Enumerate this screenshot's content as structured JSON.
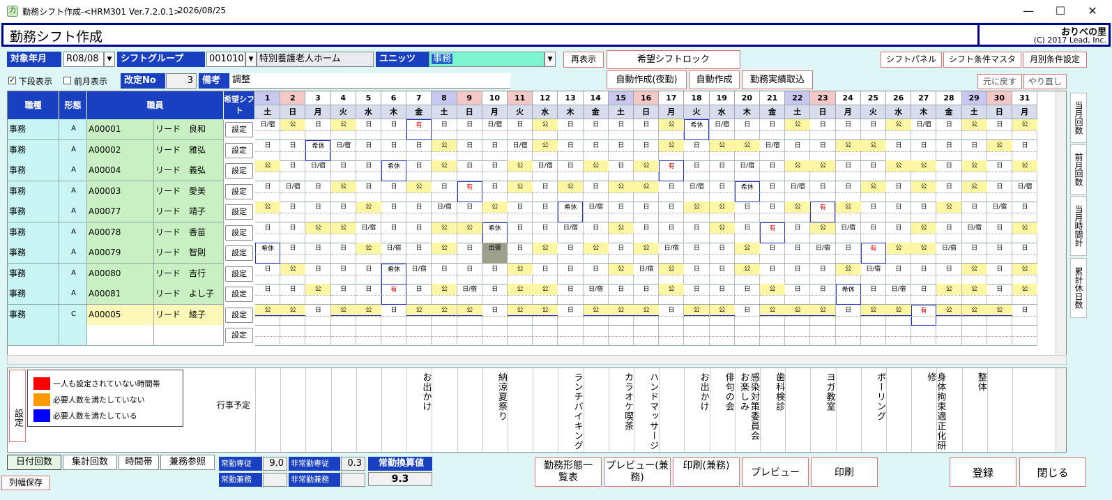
{
  "window": {
    "title": "勤務シフト作成-<HRM301 Ver.7.2.0.1>",
    "date": "2026/08/25",
    "icon_text": "力"
  },
  "header": {
    "title": "勤務シフト作成",
    "brand": "おりべの里",
    "copyright": "(C) 2017 Lead, Inc."
  },
  "filters": {
    "month_label": "対象年月",
    "month_value": "R08/08",
    "group_label": "シフトグループ",
    "group_code": "001010",
    "group_name": "特別養護老人ホーム",
    "unit_label": "ユニッツ",
    "unit_value": "事務",
    "show_lower": "下段表示",
    "show_prev": "前月表示",
    "revision_label": "改定No",
    "revision_value": "3",
    "note_label": "備考",
    "note_value": "調整"
  },
  "buttons": {
    "refresh": "再表示",
    "lock": "希望シフトロック",
    "auto_night": "自動作成(夜勤)",
    "auto": "自動作成",
    "import": "勤務実績取込",
    "panel": "シフトパネル",
    "master": "シフト条件マスタ",
    "monthly": "月別条件設定",
    "undo": "元に戻す",
    "redo": "やり直し",
    "set": "設定"
  },
  "grid": {
    "headers": {
      "job": "職種",
      "form": "形態",
      "staff": "職員",
      "hope": "希望シフト"
    },
    "days": [
      {
        "d": "1",
        "w": "土",
        "t": "sat"
      },
      {
        "d": "2",
        "w": "日",
        "t": "sun"
      },
      {
        "d": "3",
        "w": "月",
        "t": ""
      },
      {
        "d": "4",
        "w": "火",
        "t": ""
      },
      {
        "d": "5",
        "w": "水",
        "t": ""
      },
      {
        "d": "6",
        "w": "木",
        "t": ""
      },
      {
        "d": "7",
        "w": "金",
        "t": ""
      },
      {
        "d": "8",
        "w": "土",
        "t": "sat"
      },
      {
        "d": "9",
        "w": "日",
        "t": "sun"
      },
      {
        "d": "10",
        "w": "月",
        "t": ""
      },
      {
        "d": "11",
        "w": "火",
        "t": "sun"
      },
      {
        "d": "12",
        "w": "水",
        "t": ""
      },
      {
        "d": "13",
        "w": "木",
        "t": ""
      },
      {
        "d": "14",
        "w": "金",
        "t": ""
      },
      {
        "d": "15",
        "w": "土",
        "t": "sat"
      },
      {
        "d": "16",
        "w": "日",
        "t": "sun"
      },
      {
        "d": "17",
        "w": "月",
        "t": ""
      },
      {
        "d": "18",
        "w": "火",
        "t": ""
      },
      {
        "d": "19",
        "w": "水",
        "t": ""
      },
      {
        "d": "20",
        "w": "木",
        "t": ""
      },
      {
        "d": "21",
        "w": "金",
        "t": ""
      },
      {
        "d": "22",
        "w": "土",
        "t": "sat"
      },
      {
        "d": "23",
        "w": "日",
        "t": "sun"
      },
      {
        "d": "24",
        "w": "月",
        "t": ""
      },
      {
        "d": "25",
        "w": "火",
        "t": ""
      },
      {
        "d": "26",
        "w": "水",
        "t": ""
      },
      {
        "d": "27",
        "w": "木",
        "t": ""
      },
      {
        "d": "28",
        "w": "金",
        "t": ""
      },
      {
        "d": "29",
        "w": "土",
        "t": "sat"
      },
      {
        "d": "30",
        "w": "日",
        "t": "sun"
      },
      {
        "d": "31",
        "w": "月",
        "t": ""
      }
    ],
    "rows": [
      {
        "job": "事務",
        "form": "A",
        "code": "A00001",
        "name": "リード　良和",
        "shifts": [
          "日/宿",
          "公",
          "日",
          "公",
          "日",
          "日",
          "有",
          "日",
          "日",
          "日/宿",
          "日",
          "公",
          "日",
          "日",
          "日",
          "日",
          "公",
          "希休",
          "日/宿",
          "日",
          "日",
          "公",
          "日",
          "日",
          "日",
          "公",
          "日/宿",
          "日",
          "公",
          "日",
          "公"
        ]
      },
      {
        "job": "事務",
        "form": "A",
        "code": "A00002",
        "name": "リード　雅弘",
        "shifts": [
          "日",
          "日",
          "希休",
          "日/宿",
          "日",
          "日",
          "日",
          "公",
          "日",
          "日",
          "日/宿",
          "公",
          "日",
          "日",
          "日",
          "日",
          "公",
          "日",
          "公",
          "公",
          "日/宿",
          "日",
          "日",
          "公",
          "公",
          "日",
          "日",
          "日",
          "日",
          "公",
          "日"
        ]
      },
      {
        "job": "事務",
        "form": "A",
        "code": "A00004",
        "name": "リード　義弘",
        "shifts": [
          "公",
          "日",
          "日/宿",
          "日",
          "日",
          "希休",
          "日",
          "公",
          "日",
          "日",
          "公",
          "日/宿",
          "日",
          "公",
          "日",
          "公",
          "有",
          "日",
          "日",
          "日/宿",
          "日",
          "公",
          "公",
          "日",
          "日",
          "公",
          "公",
          "日",
          "公",
          "日",
          "公"
        ]
      },
      {
        "job": "事務",
        "form": "A",
        "code": "A00003",
        "name": "リード　愛美",
        "shifts": [
          "日",
          "日/宿",
          "日",
          "公",
          "日",
          "日",
          "公",
          "日",
          "有",
          "日",
          "公",
          "日",
          "公",
          "日",
          "公",
          "公",
          "日",
          "日/宿",
          "日",
          "希休",
          "日",
          "日/宿",
          "日",
          "日",
          "公",
          "日",
          "公",
          "日",
          "公",
          "日",
          "日/宿"
        ]
      },
      {
        "job": "事務",
        "form": "A",
        "code": "A00077",
        "name": "リード　靖子",
        "shifts": [
          "公",
          "日",
          "日",
          "日",
          "公",
          "日",
          "日",
          "日/宿",
          "日",
          "公",
          "日",
          "日",
          "希休",
          "日/宿",
          "日",
          "日",
          "日",
          "公",
          "公",
          "日",
          "日",
          "公",
          "有",
          "公",
          "日",
          "日",
          "日",
          "公",
          "日",
          "日/宿",
          "日"
        ]
      },
      {
        "job": "事務",
        "form": "A",
        "code": "A00078",
        "name": "リード　香苗",
        "shifts": [
          "日",
          "日",
          "公",
          "公",
          "日/宿",
          "日",
          "日",
          "公",
          "公",
          "希休",
          "日",
          "日",
          "日/宿",
          "日",
          "公",
          "日",
          "日",
          "日",
          "公",
          "日",
          "有",
          "日",
          "公",
          "日/宿",
          "日",
          "日",
          "公",
          "日",
          "日/宿",
          "日",
          "公"
        ]
      },
      {
        "job": "事務",
        "form": "A",
        "code": "A00079",
        "name": "リード　智則",
        "shifts": [
          "希休",
          "日",
          "日",
          "日",
          "公",
          "日/宿",
          "日",
          "公",
          "日",
          "出張",
          "日",
          "公",
          "日",
          "公",
          "日",
          "公",
          "日/宿",
          "日",
          "日",
          "公",
          "日",
          "日",
          "日/宿",
          "日",
          "有",
          "公",
          "公",
          "日/宿",
          "日",
          "日",
          "日"
        ]
      },
      {
        "job": "事務",
        "form": "A",
        "code": "A00080",
        "name": "リード　吉行",
        "shifts": [
          "日",
          "公",
          "日",
          "日",
          "日",
          "希休",
          "日/宿",
          "日",
          "日",
          "日",
          "公",
          "日",
          "日",
          "日",
          "公",
          "日/宿",
          "公",
          "日",
          "日",
          "公",
          "日",
          "日",
          "日",
          "公",
          "日/宿",
          "日",
          "日",
          "日",
          "公",
          "日",
          "公"
        ]
      },
      {
        "job": "事務",
        "form": "A",
        "code": "A00081",
        "name": "リード　よし子",
        "shifts": [
          "日",
          "日",
          "公",
          "日",
          "日",
          "有",
          "日",
          "公",
          "日/宿",
          "日",
          "公",
          "公",
          "日",
          "日/宿",
          "日",
          "日",
          "公",
          "日",
          "日",
          "日",
          "公",
          "日",
          "日",
          "希休",
          "日",
          "日/宿",
          "日",
          "公",
          "公",
          "日",
          "公"
        ]
      },
      {
        "job": "事務",
        "form": "C",
        "code": "A00005",
        "name": "リード　綾子",
        "shifts": [
          "公",
          "公",
          "日",
          "公",
          "公",
          "日",
          "公",
          "公",
          "公",
          "日",
          "公",
          "公",
          "日",
          "公",
          "公",
          "公",
          "日",
          "公",
          "公",
          "日",
          "公",
          "公",
          "公",
          "日",
          "公",
          "公",
          "有",
          "公",
          "公",
          "公",
          "日"
        ]
      }
    ]
  },
  "legend": {
    "set": "設定",
    "items": [
      {
        "color": "#ff0000",
        "text": "一人も設定されていない時間帯"
      },
      {
        "color": "#ff9900",
        "text": "必要人数を満たしていない"
      },
      {
        "color": "#0000ff",
        "text": "必要人数を満たしている"
      }
    ],
    "schedule_label": "行事予定"
  },
  "events": [
    {
      "col": 6,
      "lines": [
        "お出かけ"
      ]
    },
    {
      "col": 9,
      "lines": [
        "納涼夏祭り"
      ]
    },
    {
      "col": 12,
      "lines": [
        "ランチバイキング"
      ]
    },
    {
      "col": 14,
      "lines": [
        "カラオケ喫茶"
      ]
    },
    {
      "col": 15,
      "lines": [
        "ハンドマッサージ"
      ]
    },
    {
      "col": 17,
      "lines": [
        "お出かけ"
      ]
    },
    {
      "col": 18,
      "lines": [
        "俳句の会"
      ]
    },
    {
      "col": 19,
      "lines": [
        "感染対策委員会",
        "お楽しみ"
      ]
    },
    {
      "col": 20,
      "lines": [
        "歯科検診"
      ]
    },
    {
      "col": 22,
      "lines": [
        "ヨガ教室"
      ]
    },
    {
      "col": 24,
      "lines": [
        "ボーリング"
      ]
    },
    {
      "col": 26,
      "lines": [
        "身体拘束適正化研修"
      ]
    },
    {
      "col": 28,
      "lines": [
        "整体"
      ]
    }
  ],
  "side_tabs": [
    "当月回数",
    "前月回数",
    "当月時間計",
    "累計休日数"
  ],
  "bottom": {
    "tabs": [
      "日付回数",
      "集計回数",
      "時間帯",
      "兼務参照"
    ],
    "save_width": "列幅保存",
    "full_dedicated": "常勤専従",
    "full_dedicated_val": "9.0",
    "part_dedicated": "非常勤専従",
    "part_dedicated_val": "0.3",
    "full_concurrent": "常勤兼務",
    "part_concurrent": "非常勤兼務",
    "fte_label": "常勤換算値",
    "fte_value": "9.3",
    "shift_list": "勤務形態一覧表",
    "preview_c": "プレビュー(兼務)",
    "print_c": "印刷(兼務)",
    "preview": "プレビュー",
    "print": "印刷",
    "register": "登録",
    "close": "閉じる"
  },
  "colors": {
    "accent": "#1840c0",
    "holiday": "#fdf7a4",
    "background": "#dff6f6"
  }
}
